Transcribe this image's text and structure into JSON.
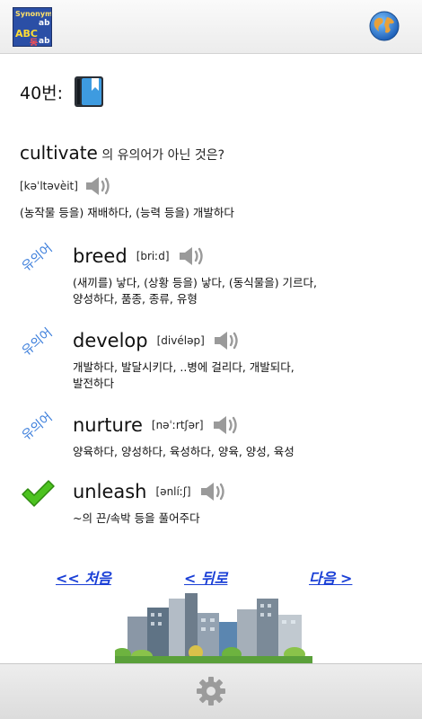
{
  "header": {
    "logo_text": [
      "Synonym",
      "ab",
      "ABC",
      "동",
      "ab"
    ]
  },
  "question": {
    "number_label": "40번:",
    "word": "cultivate",
    "prompt_suffix": " 의 유의어가 아닌 것은?",
    "pronunciation": "[kəˈltəvèit]",
    "meaning": "(농작물 등을) 재배하다, (능력 등을) 개발하다"
  },
  "choices": [
    {
      "tag": "유의어",
      "word": "breed",
      "pronunciation": "[briːd]",
      "definition_lines": [
        "(새끼를) 낳다, (상황 등을) 낳다, (동식물을) 기르다,",
        "양성하다, 품종, 종류, 유형"
      ]
    },
    {
      "tag": "유의어",
      "word": "develop",
      "pronunciation": "[divéləp]",
      "definition_lines": [
        "개발하다, 발달시키다, ..병에 걸리다, 개발되다,",
        "발전하다"
      ]
    },
    {
      "tag": "유의어",
      "word": "nurture",
      "pronunciation": "[nəˈːrtʃər]",
      "definition_lines": [
        "양육하다, 양성하다, 육성하다, 양육, 양성, 육성"
      ]
    },
    {
      "tag": "",
      "word": "unleash",
      "pronunciation": "[ənlíːʃ]",
      "definition_lines": [
        "~의 끈/속박 등을 풀어주다"
      ]
    }
  ],
  "navigation": {
    "first_label": "<< 처음",
    "back_label": "< 뒤로",
    "next_label": "다음 >"
  },
  "colors": {
    "synonym_tag": "#3a7ddb",
    "link": "#1a3fd6",
    "check": "#4cc21f"
  }
}
